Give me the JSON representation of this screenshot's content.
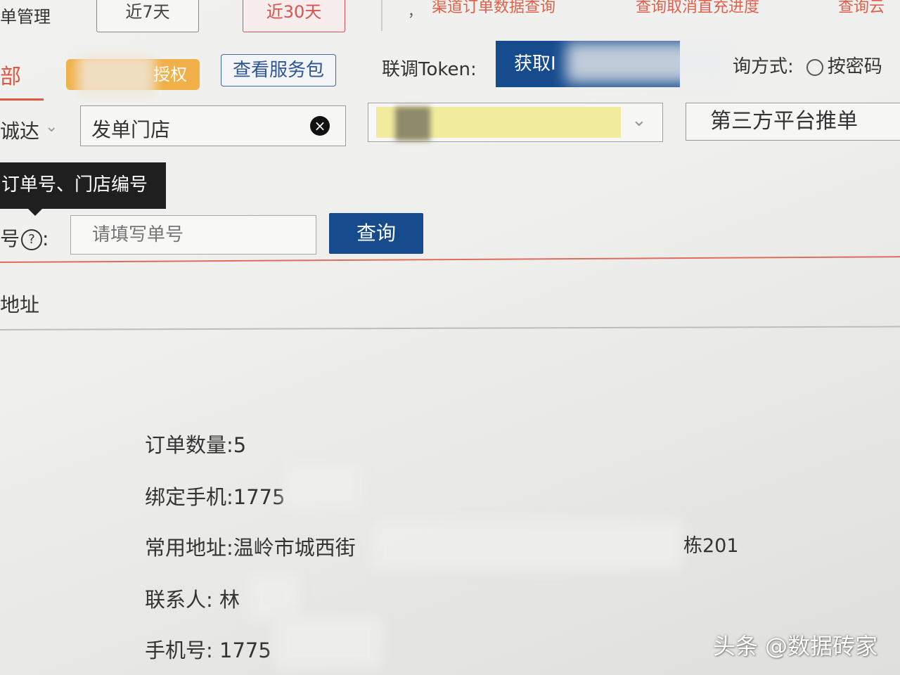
{
  "top": {
    "menu_title": "单管理",
    "day7": "近7天",
    "day30": "近30天",
    "separator_dot": "，",
    "link_channel": "渠道订单数据查询",
    "link_cancel": "查询取消直充进度",
    "link_more": "查询云"
  },
  "toolbar": {
    "tab_all": "部",
    "auth_label": "授权",
    "service_pack": "查看服务包",
    "token_label": "联调Token:",
    "token_button": "获取I",
    "query_mode": "询方式:",
    "query_mode_option": "按密码"
  },
  "filters": {
    "platform": "诚达",
    "store_label": "发单门店",
    "select_value": "",
    "third_party_button": "第三方平台推单"
  },
  "tooltip": {
    "text": "订单号、门店编号"
  },
  "search": {
    "label": "号",
    "placeholder": "请填写单号",
    "query_button": "查询"
  },
  "result": {
    "address_header": "地址",
    "order_count": "订单数量:5",
    "bound_phone": "绑定手机:1775",
    "common_address": "常用地址:温岭市城西街",
    "address_tail": "栋201",
    "contact": "联系人: 林",
    "mobile": "手机号: 1775"
  },
  "watermark": "头条 @数据砖家",
  "icons": {
    "clear": "close-circle-icon",
    "caret": "chevron-down-icon",
    "help": "question-circle-icon",
    "radio": "radio-icon"
  },
  "colors": {
    "primary": "#164b8e",
    "accent_red": "#e0563f",
    "auth_orange": "#f1b048"
  }
}
